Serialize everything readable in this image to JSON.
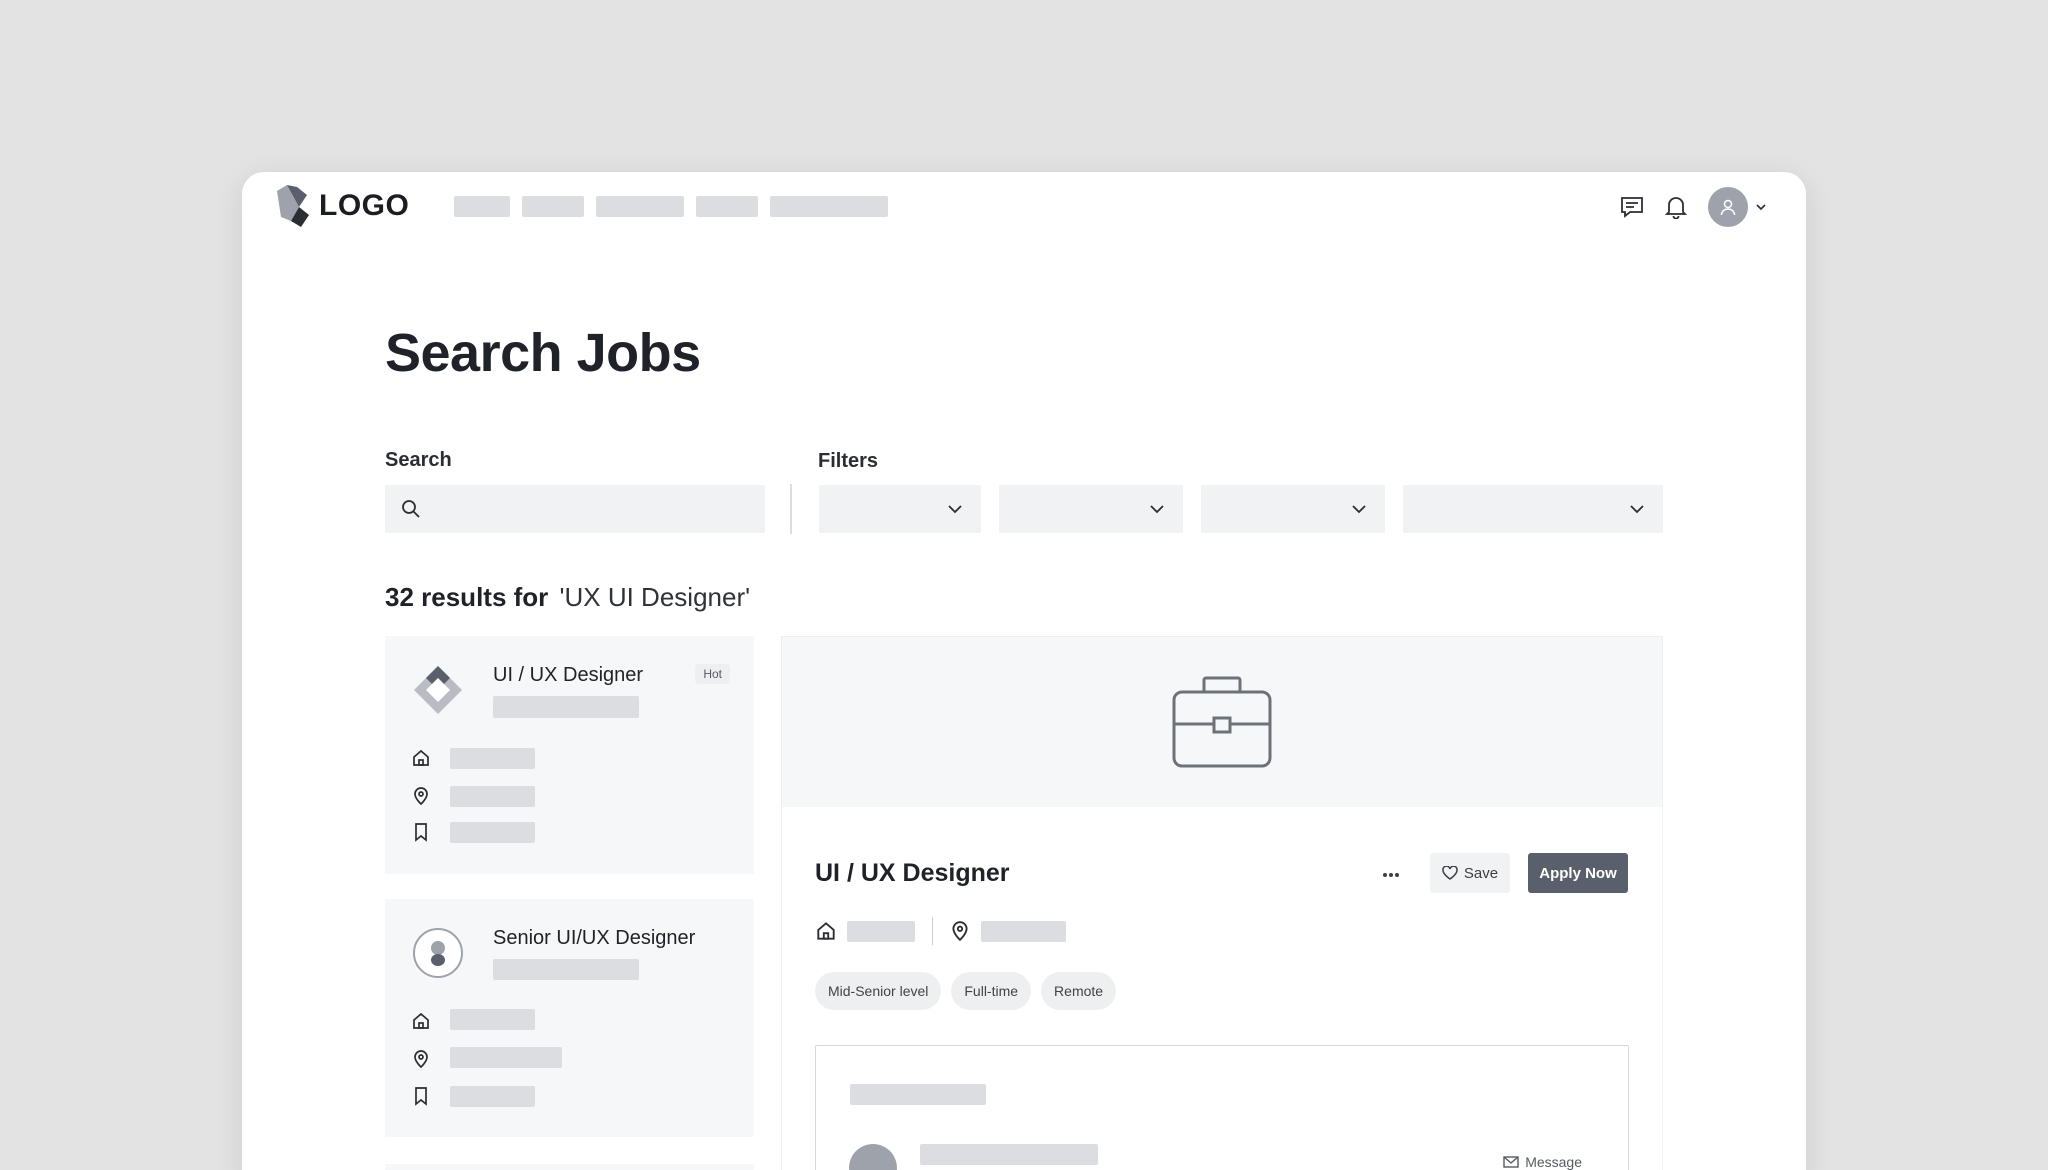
{
  "header": {
    "logo_text": "LOGO"
  },
  "page": {
    "title": "Search Jobs"
  },
  "search": {
    "label": "Search",
    "value": "",
    "placeholder": ""
  },
  "filters": {
    "label": "Filters"
  },
  "results": {
    "count_text": "32 results for",
    "query_text": "'UX UI Designer'"
  },
  "jobs": [
    {
      "title": "UI / UX Designer",
      "badge": "Hot"
    },
    {
      "title": "Senior UI/UX Designer"
    }
  ],
  "detail": {
    "title": "UI / UX Designer",
    "save_label": "Save",
    "apply_label": "Apply Now",
    "tags": [
      "Mid-Senior level",
      "Full-time",
      "Remote"
    ],
    "message_label": "Message"
  },
  "colors": {
    "primary_button": "#5a606b",
    "placeholder": "#dcdde0",
    "card_bg": "#f6f7f8"
  }
}
